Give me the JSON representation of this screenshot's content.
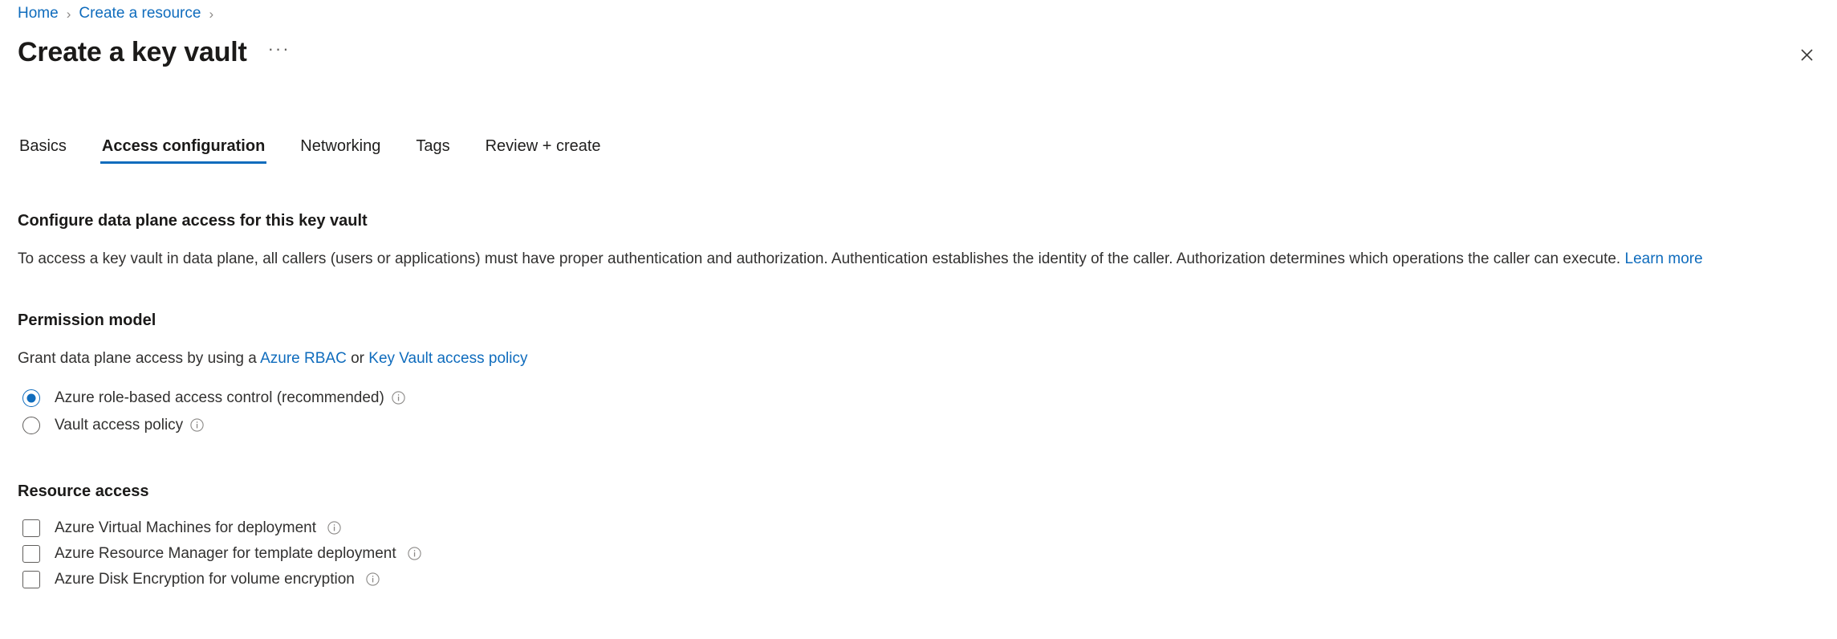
{
  "breadcrumb": {
    "items": [
      {
        "label": "Home"
      },
      {
        "label": "Create a resource"
      }
    ],
    "separator": "›"
  },
  "header": {
    "title": "Create a key vault",
    "more_label": "···",
    "close_icon": "close-icon"
  },
  "tabs": [
    {
      "label": "Basics",
      "active": false
    },
    {
      "label": "Access configuration",
      "active": true
    },
    {
      "label": "Networking",
      "active": false
    },
    {
      "label": "Tags",
      "active": false
    },
    {
      "label": "Review + create",
      "active": false
    }
  ],
  "main": {
    "data_plane": {
      "heading": "Configure data plane access for this key vault",
      "description": "To access a key vault in data plane, all callers (users or applications) must have proper authentication and authorization. Authentication establishes the identity of the caller. Authorization determines which operations the caller can execute.",
      "learn_more": "Learn more"
    },
    "permission_model": {
      "heading": "Permission model",
      "sub_prefix": "Grant data plane access by using a",
      "link_rbac": "Azure RBAC",
      "sub_middle": "or",
      "link_policy": "Key Vault access policy",
      "options": [
        {
          "label": "Azure role-based access control (recommended)",
          "selected": true,
          "info": "info-icon"
        },
        {
          "label": "Vault access policy",
          "selected": false,
          "info": "info-icon"
        }
      ]
    },
    "resource_access": {
      "heading": "Resource access",
      "options": [
        {
          "label": "Azure Virtual Machines for deployment",
          "checked": false,
          "info": "info-icon"
        },
        {
          "label": "Azure Resource Manager for template deployment",
          "checked": false,
          "info": "info-icon"
        },
        {
          "label": "Azure Disk Encryption for volume encryption",
          "checked": false,
          "info": "info-icon"
        }
      ]
    }
  },
  "colors": {
    "accent": "#0f6cbd",
    "link": "#0f6cbd",
    "text": "#323130",
    "heading": "#1b1a19",
    "border": "#605e5c",
    "background": "#ffffff"
  }
}
